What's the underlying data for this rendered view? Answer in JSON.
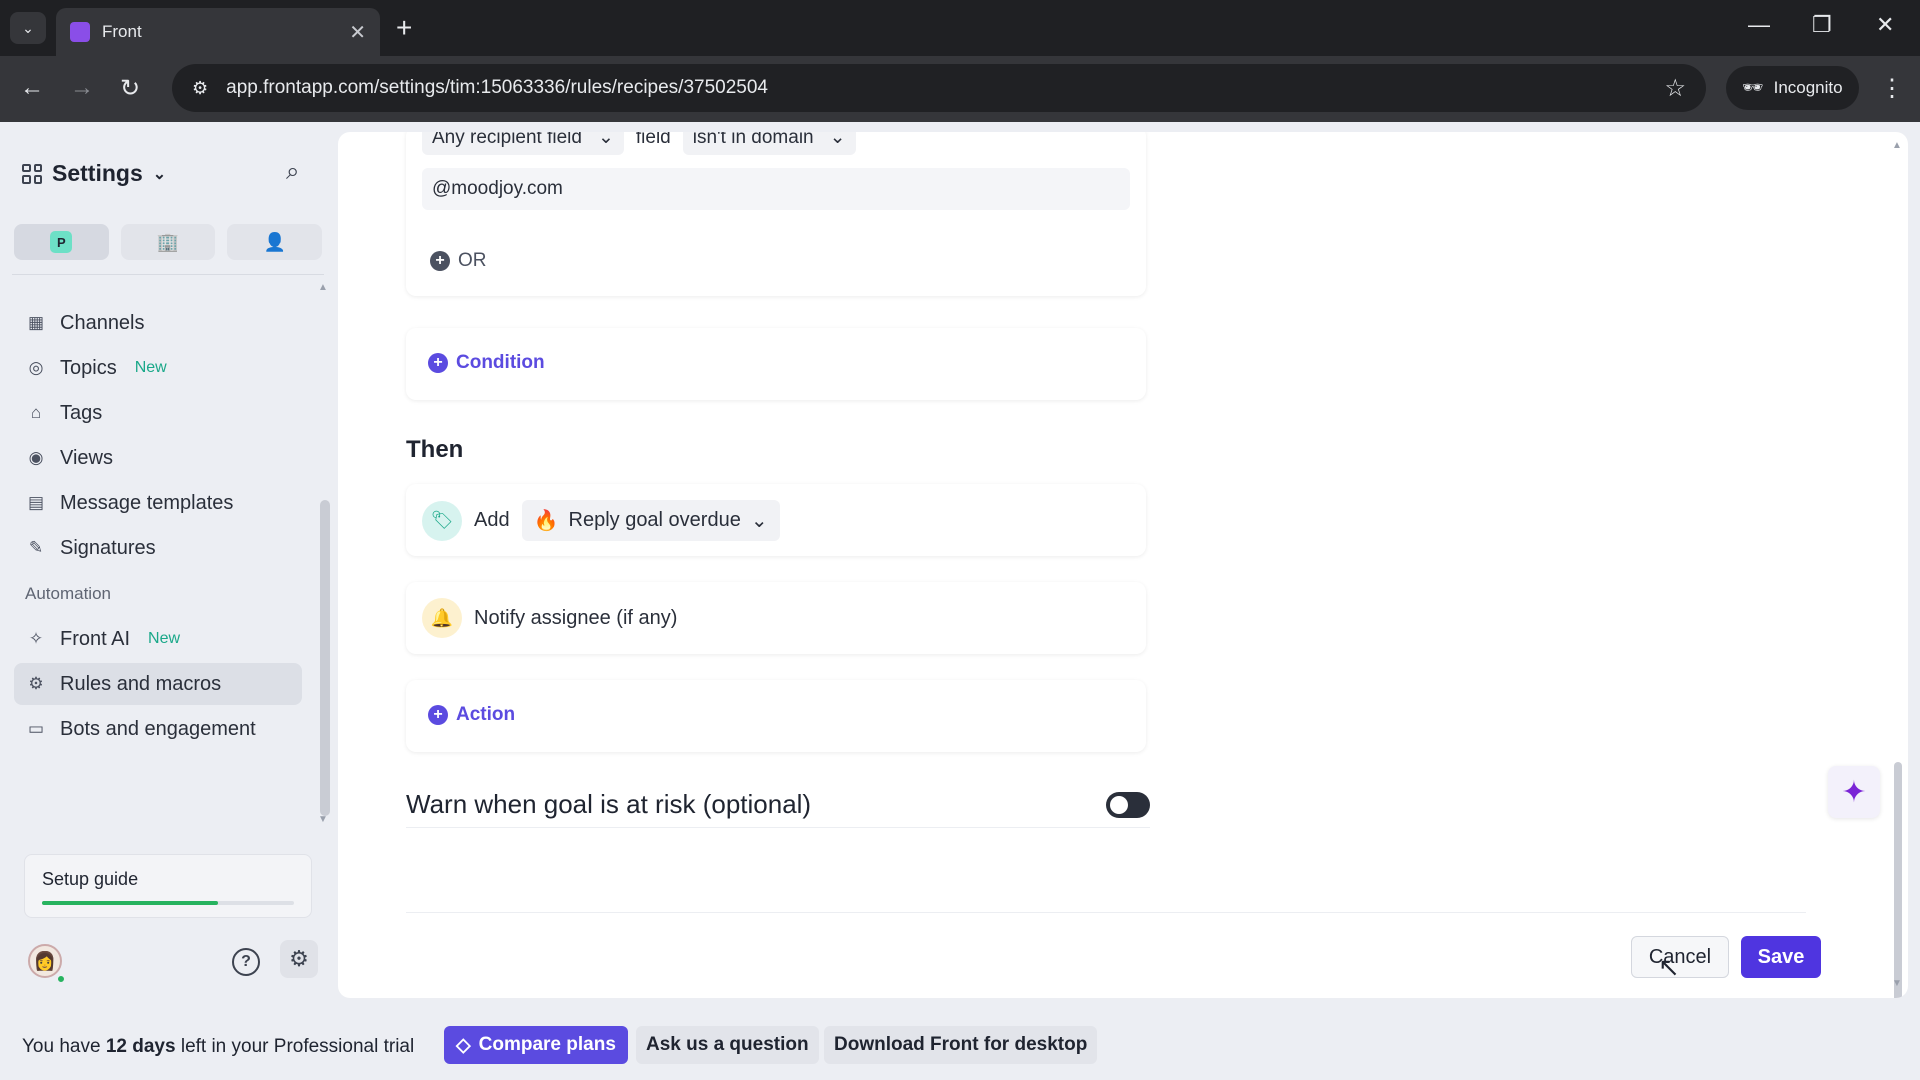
{
  "browser": {
    "tab_title": "Front",
    "url": "app.frontapp.com/settings/tim:15063336/rules/recipes/37502504",
    "incognito_label": "Incognito"
  },
  "sidebar": {
    "title": "Settings",
    "scope_badge": "P",
    "items_top": [
      {
        "label": "Channels",
        "icon": "channels-icon"
      },
      {
        "label": "Topics",
        "badge": "New",
        "icon": "topics-icon"
      },
      {
        "label": "Tags",
        "icon": "tag-icon"
      },
      {
        "label": "Views",
        "icon": "views-icon"
      },
      {
        "label": "Message templates",
        "icon": "template-icon"
      },
      {
        "label": "Signatures",
        "icon": "signature-icon"
      }
    ],
    "section_automation": "Automation",
    "items_automation": [
      {
        "label": "Front AI",
        "badge": "New",
        "icon": "sparkle-icon"
      },
      {
        "label": "Rules and macros",
        "icon": "rules-icon",
        "active": true
      },
      {
        "label": "Bots and engagement",
        "icon": "bots-icon"
      }
    ],
    "setup_guide": {
      "label": "Setup guide",
      "progress": 0.7
    }
  },
  "main": {
    "condition_block": {
      "field_dropdown": "Any recipient field",
      "field_word": "field",
      "operator_dropdown": "isn't in domain",
      "domain_value": "@moodjoy.com",
      "or_label": "OR"
    },
    "add_condition_label": "Condition",
    "then_heading": "Then",
    "actions": [
      {
        "verb": "Add",
        "tag_emoji": "🔥",
        "tag_label": "Reply goal overdue"
      },
      {
        "label": "Notify assignee (if any)"
      }
    ],
    "add_action_label": "Action",
    "warn_label": "Warn when goal is at risk (optional)",
    "warn_toggle_on": false,
    "cancel_label": "Cancel",
    "save_label": "Save"
  },
  "trial_bar": {
    "prefix": "You have ",
    "days": "12 days",
    "suffix": " left in your Professional trial",
    "compare_label": "Compare plans",
    "ask_label": "Ask us a question",
    "download_label": "Download Front for desktop"
  },
  "colors": {
    "accent": "#5b4be0",
    "save_button": "#4f35e0",
    "new_badge": "#1aa889",
    "progress": "#27b35f"
  }
}
